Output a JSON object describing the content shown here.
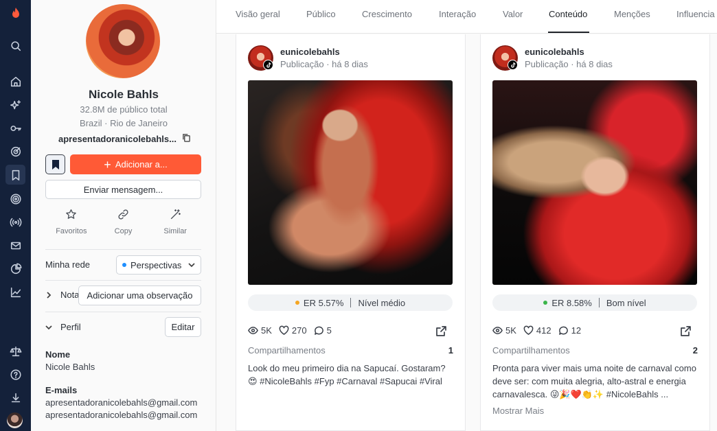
{
  "profile": {
    "name": "Nicole Bahls",
    "audience": "32.8M de público total",
    "location": "Brazil · Rio de Janeiro",
    "handle": "apresentadoranicolebahls...",
    "add_button": "Adicionar a...",
    "message_button": "Enviar mensagem...",
    "actions": {
      "favorites": "Favoritos",
      "copy": "Copy",
      "similar": "Similar"
    },
    "network_label": "Minha rede",
    "network_value": "Perspectivas",
    "notes_label": "Notas",
    "notes_placeholder": "Adicionar uma observação",
    "profile_section": "Perfil",
    "edit_button": "Editar",
    "name_label": "Nome",
    "name_value": "Nicole Bahls",
    "emails_label": "E-mails",
    "emails": [
      "apresentadoranicolebahls@gmail.com",
      "apresentadoranicolebahls@gmail.com"
    ]
  },
  "tabs": [
    "Visão geral",
    "Público",
    "Crescimento",
    "Interação",
    "Valor",
    "Conteúdo",
    "Menções",
    "Influencia"
  ],
  "active_tab": "Conteúdo",
  "posts": [
    {
      "username": "eunicolebahls",
      "meta": "Publicação · há 8 dias",
      "er": "ER 5.57%",
      "er_level": "Nível médio",
      "er_color": "#f5a623",
      "views": "5K",
      "likes": "270",
      "comments": "5",
      "shares_label": "Compartilhamentos",
      "shares": "1",
      "caption": "Look do meu primeiro dia na Sapucaí. Gostaram? 😍 #NicoleBahls #Fyp #Carnaval #Sapucai #Viral"
    },
    {
      "username": "eunicolebahls",
      "meta": "Publicação · há 8 dias",
      "er": "ER 8.58%",
      "er_level": "Bom nível",
      "er_color": "#3bb54a",
      "views": "5K",
      "likes": "412",
      "comments": "12",
      "shares_label": "Compartilhamentos",
      "shares": "2",
      "caption": "Pronta para viver mais uma noite de carnaval como deve ser: com muita alegria, alto-astral e energia carnavalesca. 😜🎉❤️👏✨ #NicoleBahls ...",
      "more": "Mostrar Mais"
    }
  ],
  "icons": {
    "rail": [
      "logo-flame-icon",
      "search-icon",
      "home-icon",
      "sparkles-icon",
      "key-icon",
      "target-icon",
      "bookmark-icon",
      "radar-icon",
      "broadcast-icon",
      "mail-icon",
      "pie-chart-icon",
      "trend-chart-icon",
      "scale-icon",
      "help-icon",
      "download-icon",
      "user-avatar"
    ]
  }
}
